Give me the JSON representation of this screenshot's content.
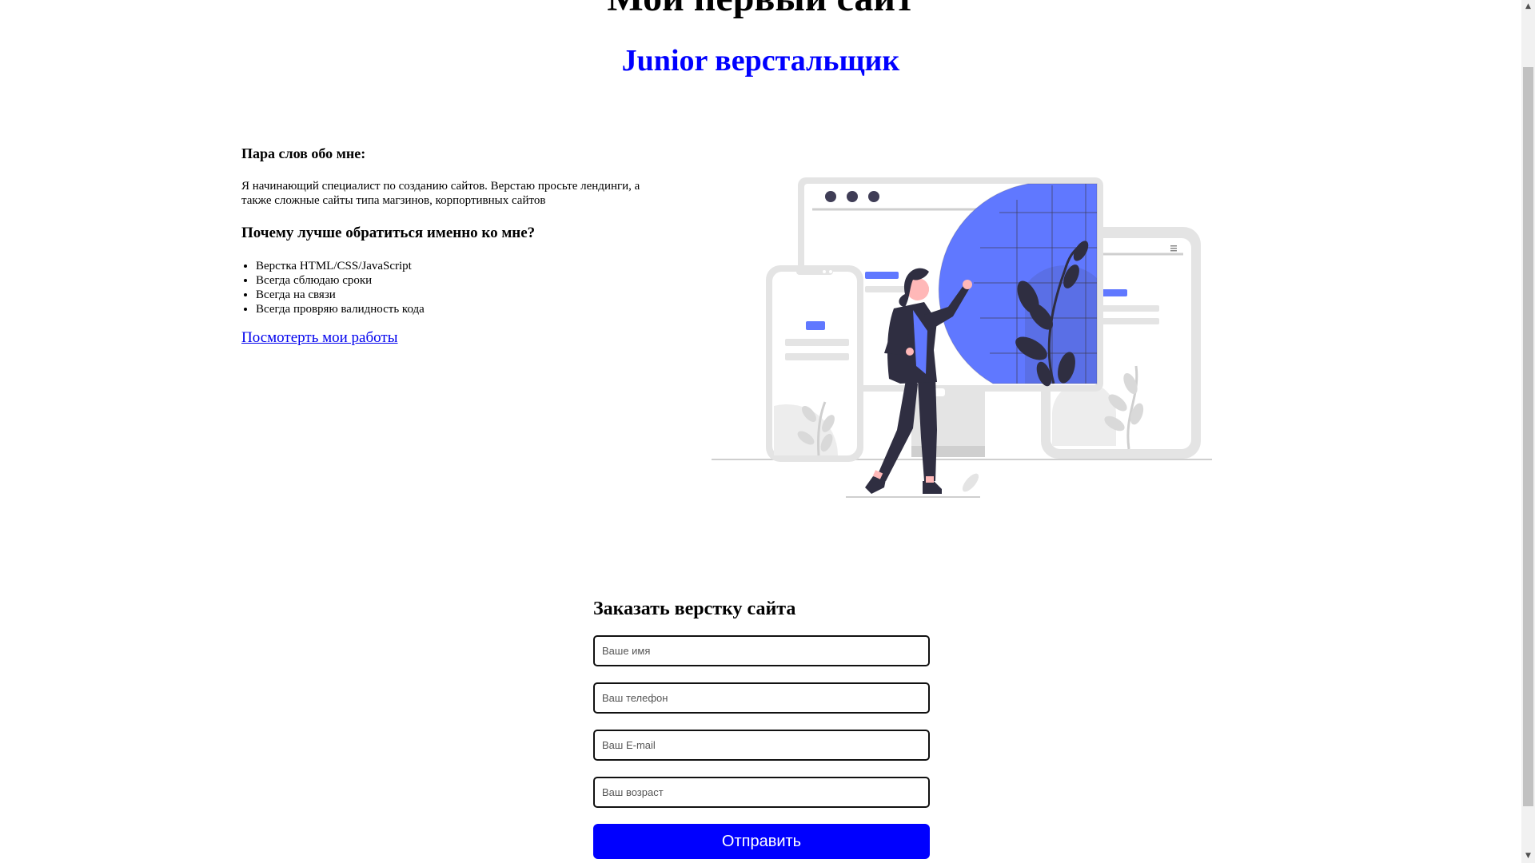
{
  "header": {
    "title": "Мой первый сайт",
    "subtitle": "Junior верстальщик"
  },
  "about": {
    "heading": "Пара слов обо мне:",
    "text": "Я начинающий специалист по созданию сайтов. Верстаю просьте лендинги, а также сложные сайты типа магзинов, корпортивных сайтов",
    "why_heading": "Почему лучше обратиться именно ко мне?",
    "reasons": [
      "Верстка HTML/CSS/JavaScript",
      "Всегда сблюдаю сроки",
      "Всегда на связи",
      "Всегда провряю валидность кода"
    ],
    "works_link": "Посмотерть мои работы"
  },
  "illustration": {
    "icon": "web-developer-illustration",
    "accent_color": "#6078ff"
  },
  "order_form": {
    "heading": "Заказать верстку сайта",
    "name_placeholder": "Ваше имя",
    "phone_placeholder": "Ваш телефон",
    "email_placeholder": "Ваш E-mail",
    "age_placeholder": "Ваш возраст",
    "submit_label": "Отправить",
    "submit_color": "#0000ff"
  }
}
